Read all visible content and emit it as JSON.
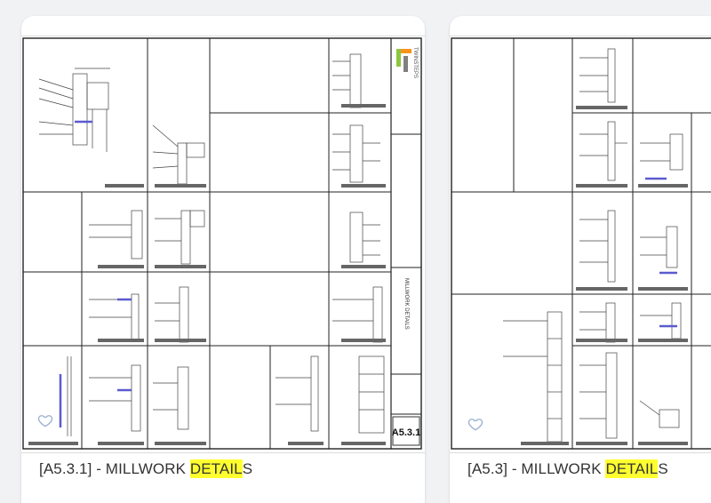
{
  "cards": [
    {
      "title_prefix": "[A5.3.1] - MILLWORK ",
      "title_highlight": "DETAIL",
      "title_suffix": "S",
      "sheet_number": "A5.3.1",
      "sheet_title": "MILLWORK DETAILS",
      "brand_text": "TWINSTEPS",
      "favorite_icon": "heart-outline-icon"
    },
    {
      "title_prefix": "[A5.3] - MILLWORK ",
      "title_highlight": "DETAIL",
      "title_suffix": "S",
      "favorite_icon": "heart-outline-icon"
    }
  ],
  "colors": {
    "highlight": "#ffff2f",
    "drawing_accent": "#5a5ad0",
    "brand_green": "#8cc63f",
    "brand_orange": "#f7941d",
    "brand_gray": "#808080"
  }
}
